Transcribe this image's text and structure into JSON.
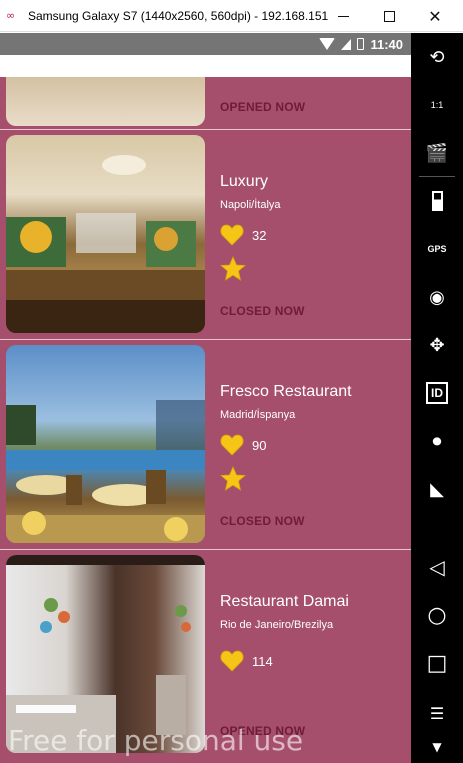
{
  "window": {
    "title": "Samsung Galaxy S7 (1440x2560, 560dpi) - 192.168.151...",
    "app_icon": "infinity-glyph"
  },
  "statusbar": {
    "time": "11:40"
  },
  "restaurants": [
    {
      "name": "",
      "location": "",
      "likes": "",
      "status": "OPENED NOW"
    },
    {
      "name": "Luxury",
      "location": "Napoli/İtalya",
      "likes": "32",
      "status": "CLOSED NOW",
      "starred": true
    },
    {
      "name": "Fresco Restaurant",
      "location": "Madrid/İspanya",
      "likes": "90",
      "status": "CLOSED NOW",
      "starred": true
    },
    {
      "name": "Restaurant Damai",
      "location": "Rio de Janeiro/Brezilya",
      "likes": "114",
      "status": "OPENED NOW",
      "starred": false
    }
  ],
  "emulator_toolbar": {
    "gps_label": "GPS",
    "id_label": "ID",
    "scale_label": "1:1",
    "icons": [
      "rotate-icon",
      "fullscreen-icon",
      "camera-clap-icon",
      "battery-icon",
      "gps-icon",
      "webcam-icon",
      "move-icon",
      "id-icon",
      "media-icon",
      "cast-icon",
      "back-icon",
      "home-icon",
      "recents-icon",
      "menu-icon"
    ]
  },
  "watermark": "Free for personal use",
  "colors": {
    "background": "#a54f6c",
    "status_text": "#6e1c3a",
    "heart": "#f5c518",
    "star": "#f5c518"
  }
}
